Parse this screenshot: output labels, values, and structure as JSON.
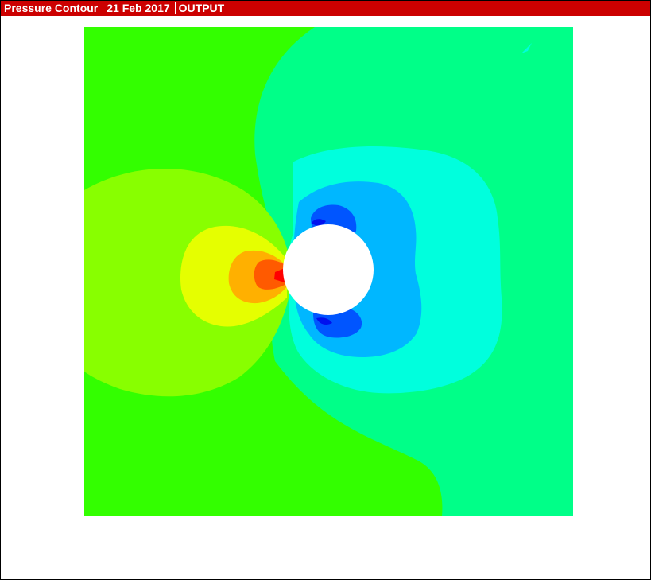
{
  "titlebar": {
    "title": "Pressure Contour",
    "date": "21 Feb 2017",
    "mode": "OUTPUT",
    "background_color": "#cc0000"
  },
  "contour_colors": {
    "far_field_left": "#33ff00",
    "far_field_right": "#00ff88",
    "upstream_band": "#88ff00",
    "stagnation_yellow": "#e5ff00",
    "stagnation_orange": "#ffb000",
    "stagnation_redorange": "#ff5a00",
    "stagnation_peak": "#ff0000",
    "wake_cyan": "#00ffdd",
    "suction_lightblue": "#00b7ff",
    "suction_blue": "#0055ff",
    "suction_peak": "#0011ee",
    "obstacle": "#ffffff"
  }
}
